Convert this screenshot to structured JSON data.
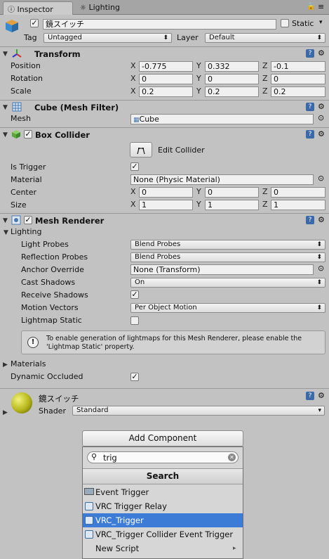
{
  "tabs": {
    "inspector": "Inspector",
    "lighting": "Lighting"
  },
  "object": {
    "name": "鏡スイッチ",
    "static_label": "Static",
    "tag_label": "Tag",
    "tag_value": "Untagged",
    "layer_label": "Layer",
    "layer_value": "Default"
  },
  "transform": {
    "title": "Transform",
    "position_label": "Position",
    "rotation_label": "Rotation",
    "scale_label": "Scale",
    "axis_x": "X",
    "axis_y": "Y",
    "axis_z": "Z",
    "position": {
      "x": "-0.775",
      "y": "0.332",
      "z": "-0.1"
    },
    "rotation": {
      "x": "0",
      "y": "0",
      "z": "0"
    },
    "scale": {
      "x": "0.2",
      "y": "0.2",
      "z": "0.2"
    }
  },
  "mesh_filter": {
    "title": "Cube (Mesh Filter)",
    "mesh_label": "Mesh",
    "mesh_value": "Cube"
  },
  "box_collider": {
    "title": "Box Collider",
    "edit_label": "Edit Collider",
    "is_trigger_label": "Is Trigger",
    "material_label": "Material",
    "material_value": "None (Physic Material)",
    "center_label": "Center",
    "size_label": "Size",
    "center": {
      "x": "0",
      "y": "0",
      "z": "0"
    },
    "size": {
      "x": "1",
      "y": "1",
      "z": "1"
    }
  },
  "mesh_renderer": {
    "title": "Mesh Renderer",
    "lighting_label": "Lighting",
    "light_probes_label": "Light Probes",
    "light_probes_value": "Blend Probes",
    "reflection_probes_label": "Reflection Probes",
    "reflection_probes_value": "Blend Probes",
    "anchor_override_label": "Anchor Override",
    "anchor_override_value": "None (Transform)",
    "cast_shadows_label": "Cast Shadows",
    "cast_shadows_value": "On",
    "receive_shadows_label": "Receive Shadows",
    "motion_vectors_label": "Motion Vectors",
    "motion_vectors_value": "Per Object Motion",
    "lightmap_static_label": "Lightmap Static",
    "info_line1": "To enable generation of lightmaps for this Mesh Renderer, please enable the",
    "info_line2": "'Lightmap Static' property.",
    "materials_label": "Materials",
    "dynamic_occluded_label": "Dynamic Occluded"
  },
  "material": {
    "name": "鏡スイッチ",
    "shader_label": "Shader",
    "shader_value": "Standard"
  },
  "add_component": {
    "button_label": "Add Component",
    "search_value": "trig",
    "list_header": "Search",
    "items": [
      {
        "label": "Event Trigger"
      },
      {
        "label": "VRC Trigger Relay"
      },
      {
        "label": "VRC_Trigger"
      },
      {
        "label": "VRC_Trigger Collider Event Trigger"
      },
      {
        "label": "New Script"
      }
    ]
  },
  "colors": {
    "selection": "#3d7cd6",
    "panel": "#c2c2c2",
    "sphere": "#b5b51a"
  }
}
